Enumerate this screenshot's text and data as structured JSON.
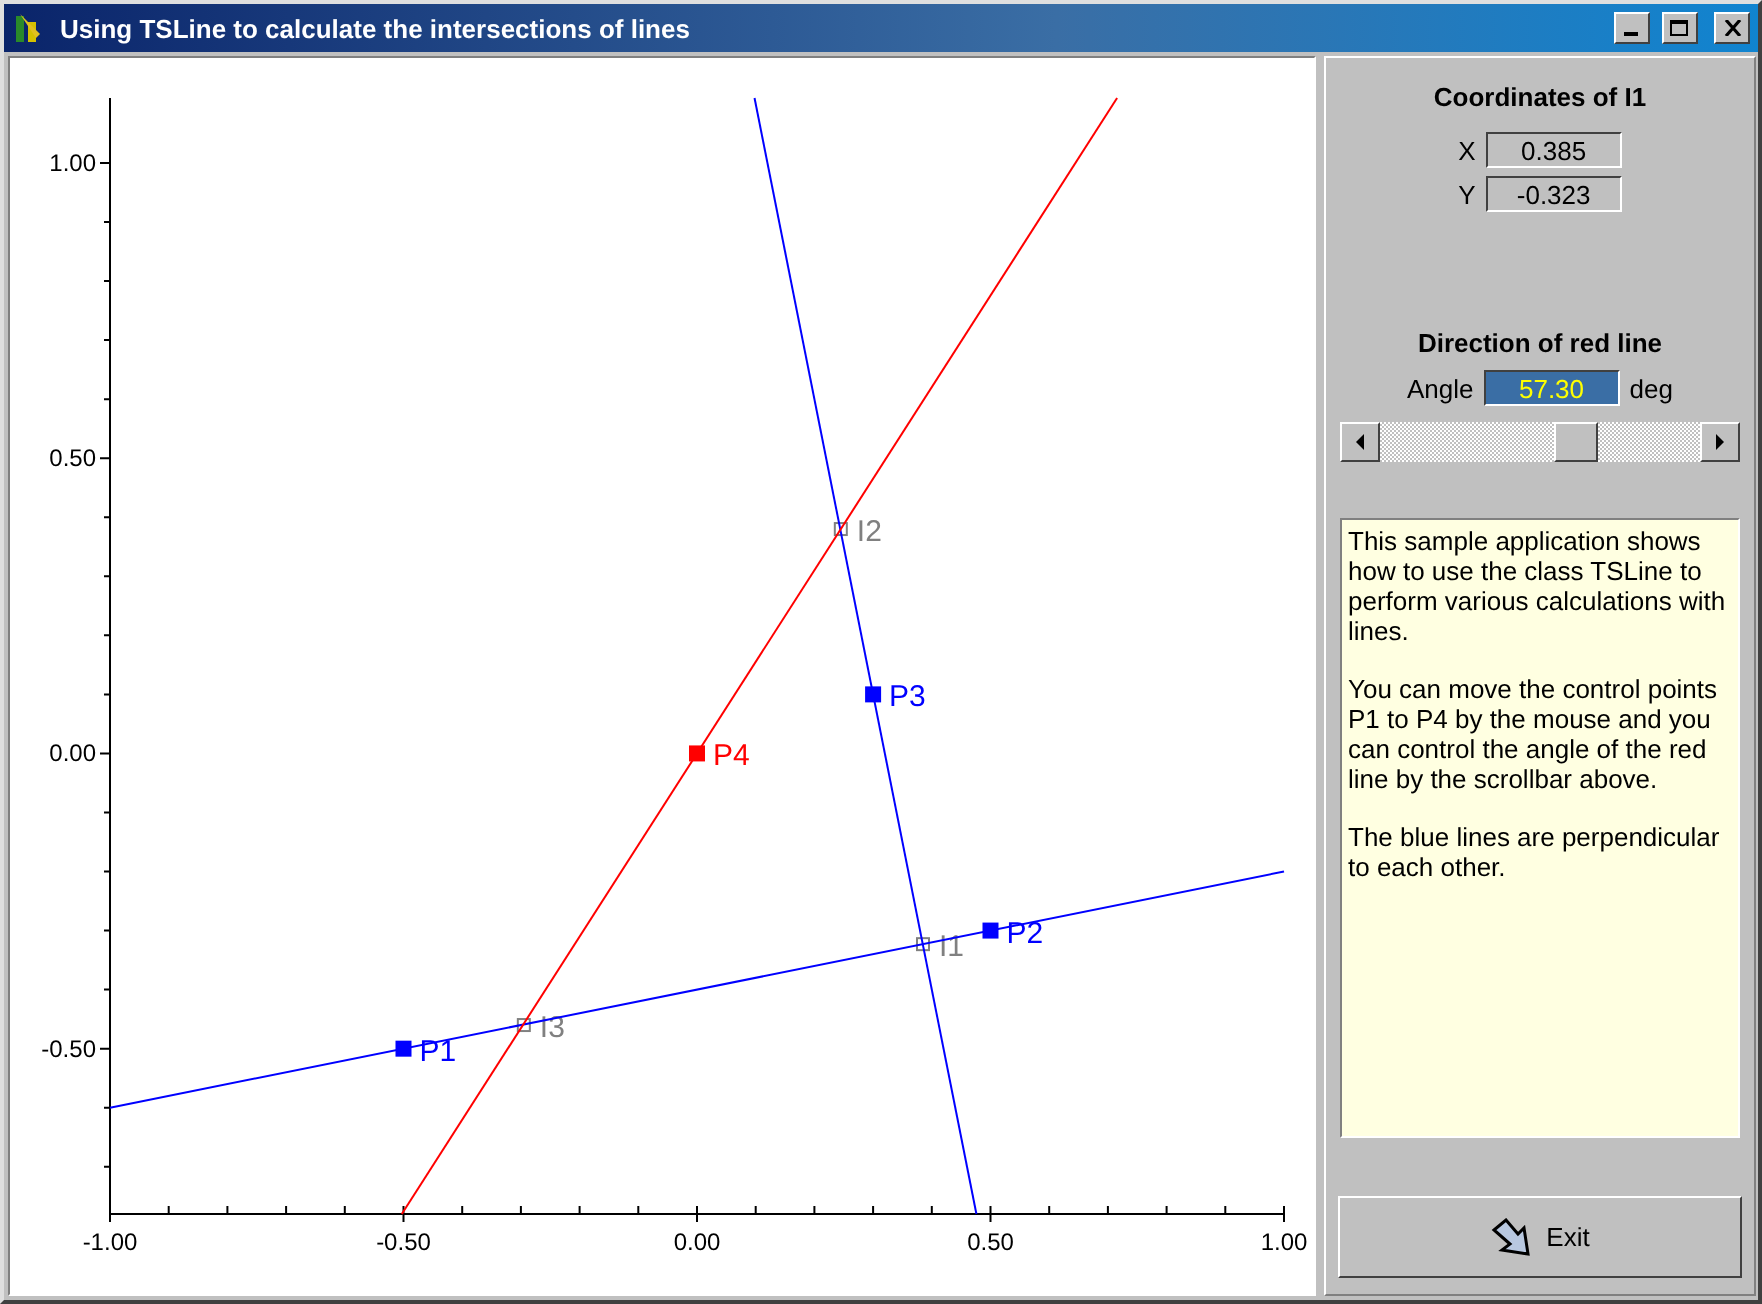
{
  "window": {
    "title": "Using TSLine to calculate the intersections of lines"
  },
  "plot": {
    "chart_data": {
      "type": "scatter",
      "x": [
        -0.5,
        0.5,
        0.3,
        0,
        0.385,
        0.245,
        -0.295
      ],
      "xlim": [
        -1,
        1
      ],
      "ylim": [
        -0.78,
        1.11
      ],
      "xticks": [
        {
          "value": -1,
          "label": "-1.00"
        },
        {
          "value": -0.5,
          "label": "-0.50"
        },
        {
          "value": 0,
          "label": "0.00"
        },
        {
          "value": 0.5,
          "label": "0.50"
        },
        {
          "value": 1,
          "label": "1.00"
        }
      ],
      "yticks": [
        {
          "value": -0.5,
          "label": "-0.50"
        },
        {
          "value": 0,
          "label": "0.00"
        },
        {
          "value": 0.5,
          "label": "0.50"
        },
        {
          "value": 1,
          "label": "1.00"
        }
      ],
      "series": [
        {
          "name": "P1",
          "color": "#0000ff",
          "values": [
            -0.5,
            null,
            null,
            null,
            null,
            null,
            null
          ]
        },
        {
          "name": "P2",
          "color": "#0000ff",
          "values": [
            null,
            -0.3,
            null,
            null,
            null,
            null,
            null
          ]
        },
        {
          "name": "P3",
          "color": "#0000ff",
          "values": [
            null,
            null,
            0.1,
            null,
            null,
            null,
            null
          ]
        },
        {
          "name": "P4",
          "color": "#ff0000",
          "values": [
            null,
            null,
            null,
            0,
            null,
            null,
            null
          ]
        },
        {
          "name": "I1",
          "color": "#808080",
          "values": [
            null,
            null,
            null,
            null,
            -0.323,
            null,
            null
          ]
        },
        {
          "name": "I2",
          "color": "#808080",
          "values": [
            null,
            null,
            null,
            null,
            null,
            0.38,
            null
          ]
        },
        {
          "name": "I3",
          "color": "#808080",
          "values": [
            null,
            null,
            null,
            null,
            null,
            null,
            -0.46
          ]
        }
      ]
    }
  },
  "coordinates": {
    "title": "Coordinates of I1",
    "fields": [
      {
        "label": "X",
        "value": "0.385"
      },
      {
        "label": "Y",
        "value": "-0.323"
      }
    ]
  },
  "direction": {
    "title": "Direction of red line",
    "label": "Angle",
    "value": "57.30",
    "unit": "deg",
    "slider": {
      "level": 0.63
    }
  },
  "info": {
    "paragraphs": [
      "This sample application shows how to use the class TSLine to perform various calculations with lines.",
      "You can move the control points P1 to P4 by the mouse and you can control the angle of the red line by the scrollbar above.",
      "The blue lines are perpendicular to each other."
    ]
  },
  "exit_button": {
    "label": "Exit"
  }
}
